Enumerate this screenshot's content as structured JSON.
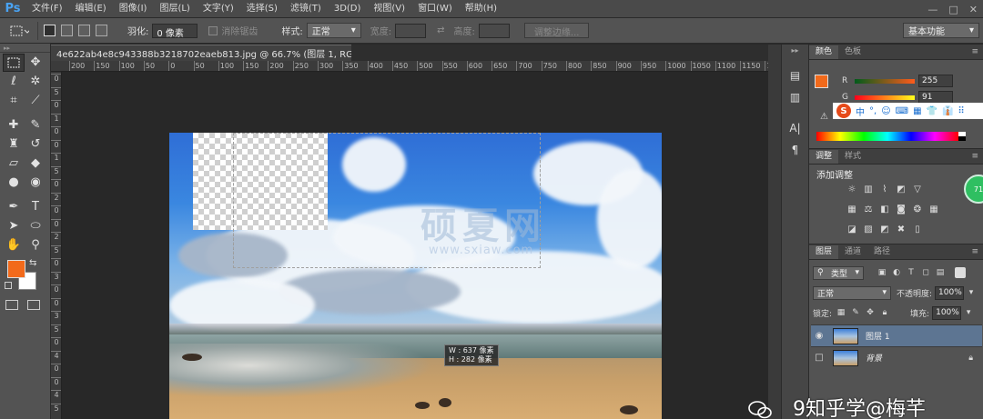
{
  "app": {
    "logo": "Ps"
  },
  "menubar": {
    "items": [
      "文件(F)",
      "编辑(E)",
      "图像(I)",
      "图层(L)",
      "文字(Y)",
      "选择(S)",
      "滤镜(T)",
      "3D(D)",
      "视图(V)",
      "窗口(W)",
      "帮助(H)"
    ],
    "minimize": "—",
    "maximize": "□",
    "close": "✕"
  },
  "options": {
    "feather_label": "羽化:",
    "feather_value": "0 像素",
    "antialias_label": "消除锯齿",
    "style_label": "样式:",
    "style_value": "正常",
    "width_label": "宽度:",
    "height_label": "高度:",
    "refine_edge": "调整边缘...",
    "workspace": "基本功能"
  },
  "document": {
    "tab_title": "4e622ab4e8c943388b3218702eaeb813.jpg @ 66.7% (图层 1, RGB/8#) *",
    "close": "×",
    "ruler_top": [
      "200",
      "150",
      "100",
      "50",
      "0",
      "50",
      "100",
      "150",
      "200",
      "250",
      "300",
      "350",
      "400",
      "450",
      "500",
      "550",
      "600",
      "650",
      "700",
      "750",
      "800",
      "850",
      "900",
      "950",
      "1000",
      "1050",
      "1100",
      "1150",
      "1200"
    ],
    "ruler_left": [
      "0",
      "5",
      "0",
      "1",
      "0",
      "0",
      "1",
      "5",
      "0",
      "2",
      "0",
      "0",
      "2",
      "5",
      "0",
      "3",
      "0",
      "0",
      "3",
      "5",
      "0",
      "4",
      "0",
      "0",
      "4",
      "5"
    ],
    "watermark_cn": "硕夏网",
    "watermark_url": "www.sxiaw.com",
    "size_w": "W : 637 像素",
    "size_h": "H : 282 像素"
  },
  "color_panel": {
    "tabs": [
      "颜色",
      "色板"
    ],
    "r_label": "R",
    "r_value": "255",
    "g_label": "G",
    "g_value": "91",
    "ime": [
      "中",
      "°,",
      "☺",
      "⌨",
      "▦",
      "👕",
      "👔",
      "⠿"
    ]
  },
  "adjust_panel": {
    "tabs": [
      "调整",
      "样式"
    ],
    "title": "添加调整",
    "badge": "71"
  },
  "layers_panel": {
    "tabs": [
      "图层",
      "通道",
      "路径"
    ],
    "filter_value": "类型",
    "blend_value": "正常",
    "opacity_label": "不透明度:",
    "opacity_value": "100%",
    "lock_label": "锁定:",
    "fill_label": "填充:",
    "fill_value": "100%",
    "layers": [
      {
        "name": "图层 1"
      },
      {
        "name": "背景"
      }
    ]
  },
  "watermark": {
    "text": "9知乎学@梅芊"
  }
}
